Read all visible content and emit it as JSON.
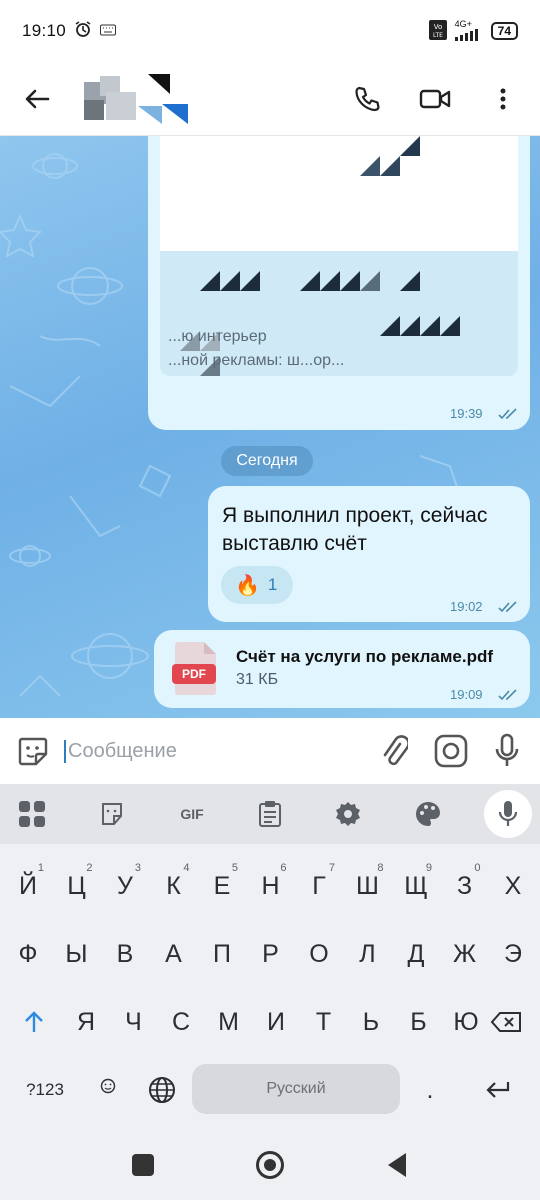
{
  "status_bar": {
    "time": "19:10",
    "network": "4G+",
    "volte": "VoLTE",
    "battery": "74"
  },
  "header": {
    "back_icon": "back-arrow-icon",
    "call_icon": "phone-icon",
    "video_icon": "video-camera-icon",
    "menu_icon": "more-vert-icon"
  },
  "chat": {
    "previous_message": {
      "line1": "...ю интерьер",
      "line2": "...ной рекламы: ш...ор...",
      "time": "19:39"
    },
    "date_separator": "Сегодня",
    "messages": [
      {
        "text": "Я выполнил проект, сейчас выставлю счёт",
        "reaction_emoji": "🔥",
        "reaction_count": "1",
        "time": "19:02"
      },
      {
        "file_badge": "PDF",
        "file_name": "Счёт на услуги по рекламе.pdf",
        "file_size": "31 КБ",
        "time": "19:09"
      }
    ]
  },
  "input": {
    "placeholder": "Сообщение"
  },
  "keyboard": {
    "toolbar_gif": "GIF",
    "row1": [
      {
        "key": "Й",
        "hint": "1"
      },
      {
        "key": "Ц",
        "hint": "2"
      },
      {
        "key": "У",
        "hint": "3"
      },
      {
        "key": "К",
        "hint": "4"
      },
      {
        "key": "Е",
        "hint": "5"
      },
      {
        "key": "Н",
        "hint": "6"
      },
      {
        "key": "Г",
        "hint": "7"
      },
      {
        "key": "Ш",
        "hint": "8"
      },
      {
        "key": "Щ",
        "hint": "9"
      },
      {
        "key": "З",
        "hint": "0"
      },
      {
        "key": "Х",
        "hint": ""
      }
    ],
    "row2": [
      "Ф",
      "Ы",
      "В",
      "А",
      "П",
      "Р",
      "О",
      "Л",
      "Д",
      "Ж",
      "Э"
    ],
    "row3": [
      "Я",
      "Ч",
      "С",
      "М",
      "И",
      "Т",
      "Ь",
      "Б",
      "Ю"
    ],
    "symbols_key": "?123",
    "space_label": "Русский",
    "period_key": "."
  },
  "colors": {
    "bubble": "#e1f5fe",
    "accent": "#2d7fb8",
    "pdf_red": "#e2464f"
  }
}
